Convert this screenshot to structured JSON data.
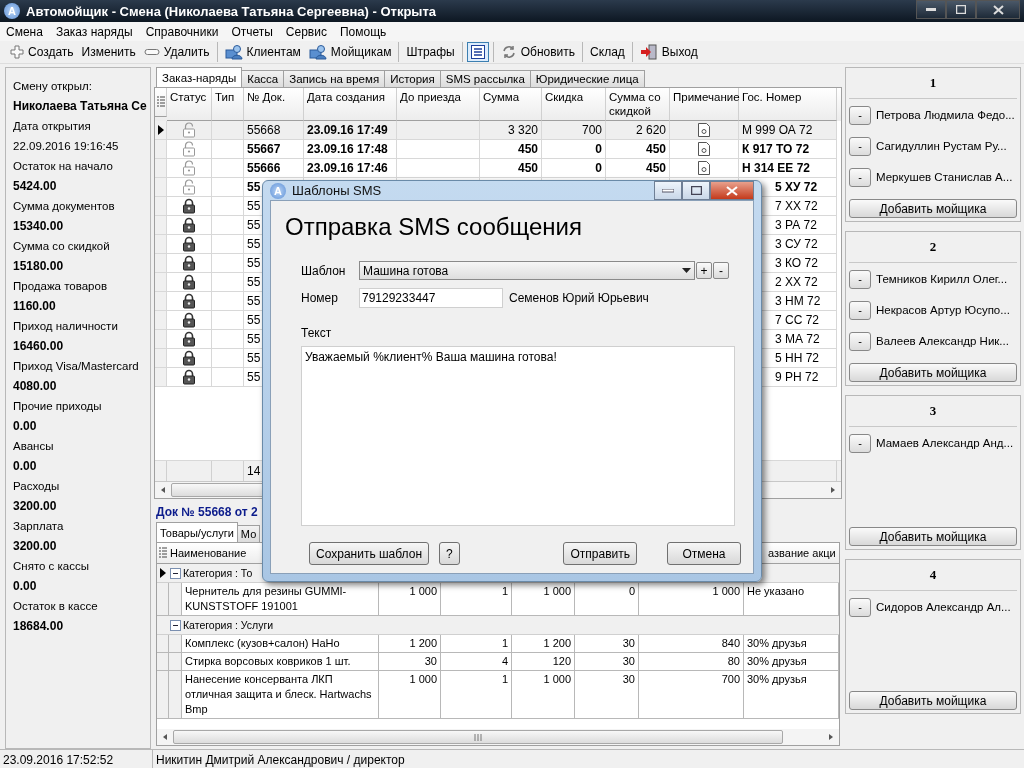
{
  "window": {
    "app_letter": "A",
    "title": "Автомойщик - Смена (Николаева Татьяна Сергеевна) - Открыта"
  },
  "menu": [
    "Смена",
    "Заказ наряды",
    "Справочники",
    "Отчеты",
    "Сервис",
    "Помощь"
  ],
  "toolbar": [
    [
      {
        "label": "Создать",
        "pressed": false
      },
      {
        "label": "Изменить",
        "pressed": false
      },
      {
        "label": "Удалить",
        "pressed": false
      }
    ],
    [
      {
        "label": "Клиентам",
        "pressed": false
      },
      {
        "label": "Мойщикам",
        "pressed": false
      }
    ],
    [
      {
        "label": "Штрафы",
        "pressed": false
      }
    ],
    [
      {
        "pressed": true
      }
    ],
    [
      {
        "label": "Обновить",
        "pressed": false
      }
    ],
    [
      {
        "label": "Склад",
        "pressed": false
      }
    ],
    [
      {
        "label": "Выход",
        "pressed": false
      }
    ]
  ],
  "shift_panel": [
    {
      "label": "Смену открыл:",
      "value": "Николаева Татьяна Се",
      "bold": true
    },
    {
      "label": "Дата открытия",
      "value": "22.09.2016 19:16:45",
      "bold": false
    },
    {
      "label": "Остаток на начало",
      "value": "5424.00",
      "bold": true
    },
    {
      "label": "Сумма документов",
      "value": "15340.00",
      "bold": true
    },
    {
      "label": "Сумма со скидкой",
      "value": "15180.00",
      "bold": true
    },
    {
      "label": "Продажа товаров",
      "value": "1160.00",
      "bold": true
    },
    {
      "label": "Приход наличности",
      "value": "16460.00",
      "bold": true
    },
    {
      "label": "Приход Visa/Mastercard",
      "value": "4080.00",
      "bold": true
    },
    {
      "label": "Прочие приходы",
      "value": "0.00",
      "bold": true
    },
    {
      "label": "Авансы",
      "value": "0.00",
      "bold": true
    },
    {
      "label": "Расходы",
      "value": "3200.00",
      "bold": true
    },
    {
      "label": "Зарплата",
      "value": "3200.00",
      "bold": true
    },
    {
      "label": "Снято с кассы",
      "value": "0.00",
      "bold": true
    },
    {
      "label": "Остаток в кассе",
      "value": "18684.00",
      "bold": true
    }
  ],
  "tabs": [
    {
      "label": "Заказ-наряды",
      "selected": true
    },
    {
      "label": "Касса",
      "selected": false
    },
    {
      "label": "Запись на время",
      "selected": false
    },
    {
      "label": "История",
      "selected": false
    },
    {
      "label": "SMS рассылка",
      "selected": false
    },
    {
      "label": "Юридические лица",
      "selected": false
    }
  ],
  "orders": {
    "columns": [
      "Статус",
      "Тип",
      "№ Док.",
      "Дата создания",
      "До приезда",
      "Сумма",
      "Скидка",
      "Сумма со скидкой",
      "Примечание",
      "Гос. Номер"
    ],
    "rows": [
      {
        "kind": "full",
        "selected": true,
        "locked": false,
        "bold": false,
        "doc": "55668",
        "created": "23.09.16 17:49",
        "sum": "3 320",
        "discount": "700",
        "total": "2 620",
        "note": true,
        "plate": "М 999 ОА 72"
      },
      {
        "kind": "full",
        "selected": false,
        "locked": false,
        "bold": true,
        "doc": "55667",
        "created": "23.09.16 17:48",
        "sum": "450",
        "discount": "0",
        "total": "450",
        "note": true,
        "plate": "К 917 ТО 72"
      },
      {
        "kind": "full",
        "selected": false,
        "locked": false,
        "bold": true,
        "doc": "55666",
        "created": "23.09.16 17:46",
        "sum": "450",
        "discount": "0",
        "total": "450",
        "note": true,
        "plate": "Н 314 ЕЕ 72"
      },
      {
        "kind": "partial",
        "selected": false,
        "locked": false,
        "bold": true,
        "doc": "55",
        "plate": "5 ХУ 72"
      },
      {
        "kind": "partial",
        "selected": false,
        "locked": true,
        "bold": false,
        "doc": "55",
        "plate": "7 ХХ 72"
      },
      {
        "kind": "partial",
        "selected": false,
        "locked": true,
        "bold": false,
        "doc": "55",
        "plate": "3 РА 72"
      },
      {
        "kind": "partial",
        "selected": false,
        "locked": true,
        "bold": false,
        "doc": "55",
        "plate": "3 СУ 72"
      },
      {
        "kind": "partial",
        "selected": false,
        "locked": true,
        "bold": false,
        "doc": "55",
        "plate": "3 КО 72"
      },
      {
        "kind": "partial",
        "selected": false,
        "locked": true,
        "bold": false,
        "doc": "55",
        "plate": "2 ХХ 72"
      },
      {
        "kind": "partial",
        "selected": false,
        "locked": true,
        "bold": false,
        "doc": "55",
        "plate": "3 НМ 72"
      },
      {
        "kind": "partial",
        "selected": false,
        "locked": true,
        "bold": false,
        "doc": "55",
        "plate": "7 СС 72"
      },
      {
        "kind": "partial",
        "selected": false,
        "locked": true,
        "bold": false,
        "doc": "55",
        "plate": "3 МА 72"
      },
      {
        "kind": "partial",
        "selected": false,
        "locked": true,
        "bold": false,
        "doc": "55",
        "plate": "5 НН 72"
      },
      {
        "kind": "partial",
        "selected": false,
        "locked": true,
        "bold": false,
        "doc": "55",
        "plate": "9 РН 72"
      }
    ],
    "footer_count": "14"
  },
  "document": {
    "title": "Док № 55668 от 2",
    "tabs": [
      {
        "label": "Товары/услуги",
        "selected": true
      },
      {
        "label": "Мо",
        "selected": false
      }
    ],
    "columns": [
      "Наименование",
      "азвание акци"
    ],
    "groups": [
      {
        "label": "Категория : То",
        "expanded": true,
        "selected": true,
        "children": [
          {
            "name": "Чернитель для резины GUMMI-KUNSTSTOFF 191001",
            "price": "1 000",
            "qty": "1",
            "sum": "1 000",
            "discount": "0",
            "total": "1 000",
            "promo": "Не указано"
          }
        ]
      },
      {
        "label": "Категория : Услуги",
        "expanded": true,
        "selected": false,
        "children": [
          {
            "name": "Комплекс (кузов+салон) НаНо",
            "price": "1 200",
            "qty": "1",
            "sum": "1 200",
            "discount": "30",
            "total": "840",
            "promo": "30% друзья"
          },
          {
            "name": "Стирка ворсовых ковриков 1 шт.",
            "price": "30",
            "qty": "4",
            "sum": "120",
            "discount": "30",
            "total": "80",
            "promo": "30% друзья"
          },
          {
            "name": "Нанесение консерванта ЛКП отличная защита и блеск. Hartwachs Bmp",
            "price": "1 000",
            "qty": "1",
            "sum": "1 000",
            "discount": "30",
            "total": "700",
            "promo": "30% друзья"
          }
        ]
      }
    ]
  },
  "teams": [
    {
      "title": "1",
      "workers": [
        {
          "remove": "-",
          "name": "Петрова Людмила Федо..."
        },
        {
          "remove": "-",
          "name": "Сагидуллин Рустам Ру..."
        },
        {
          "remove": "-",
          "name": "Меркушев Станислав А..."
        }
      ],
      "add_button": "Добавить мойщика"
    },
    {
      "title": "2",
      "workers": [
        {
          "remove": "-",
          "name": "Темников Кирилл Олег..."
        },
        {
          "remove": "-",
          "name": "Некрасов Артур Юсупо..."
        },
        {
          "remove": "-",
          "name": "Валеев Александр Ник..."
        }
      ],
      "add_button": "Добавить мойщика"
    },
    {
      "title": "3",
      "workers": [
        {
          "remove": "-",
          "name": "Мамаев Александр Анд..."
        }
      ],
      "add_button": "Добавить мойщика"
    },
    {
      "title": "4",
      "workers": [
        {
          "remove": "-",
          "name": "Сидоров Александр Ал..."
        }
      ],
      "add_button": "Добавить мойщика"
    }
  ],
  "dialog": {
    "app_letter": "A",
    "title": "Шаблоны SMS",
    "heading": "Отправка SMS сообщения",
    "template_label": "Шаблон",
    "template_value": "Машина готова",
    "add": "+",
    "remove": "-",
    "number_label": "Номер",
    "number_value": "79129233447",
    "client": "Семенов Юрий Юрьевич",
    "text_label": "Текст",
    "text_value": "Уважаемый %клиент% Ваша машина готова!",
    "buttons": [
      "Сохранить шаблон",
      "?",
      "Отправить",
      "Отмена"
    ]
  },
  "status_bar": {
    "datetime": "23.09.2016 17:52:52",
    "user": "Никитин Дмитрий Александрович / директор"
  }
}
